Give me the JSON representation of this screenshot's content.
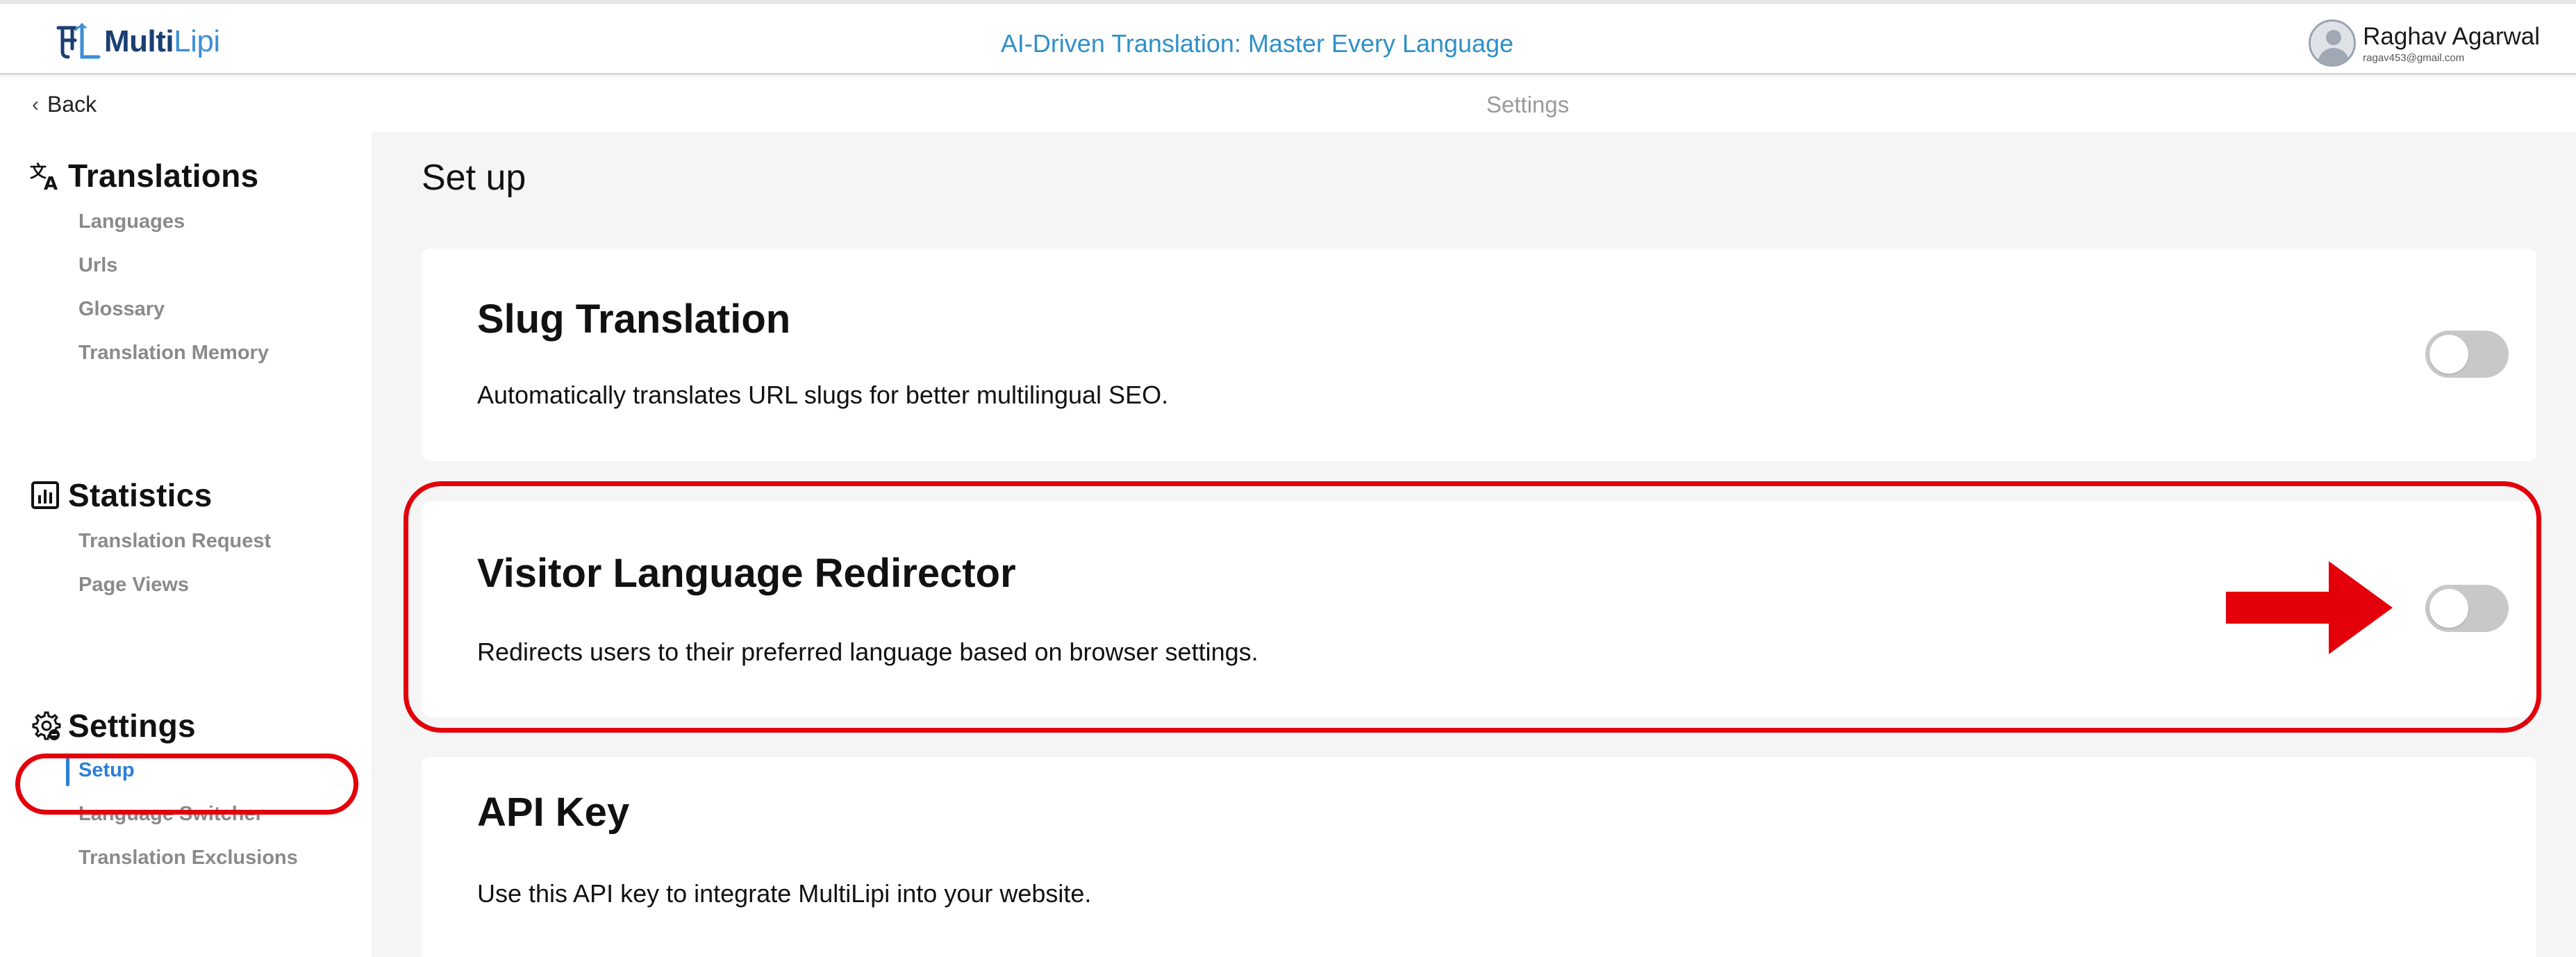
{
  "header": {
    "logo_primary": "Multi",
    "logo_secondary": "Lipi",
    "tagline": "AI-Driven Translation: Master Every Language",
    "user": {
      "name": "Raghav Agarwal",
      "email": "ragav453@gmail.com"
    }
  },
  "subbar": {
    "back_label": "Back",
    "breadcrumb": "Settings"
  },
  "sidebar": {
    "translations": {
      "title": "Translations",
      "items": [
        "Languages",
        "Urls",
        "Glossary",
        "Translation Memory"
      ]
    },
    "statistics": {
      "title": "Statistics",
      "items": [
        "Translation Request",
        "Page Views"
      ]
    },
    "settings": {
      "title": "Settings",
      "items": [
        "Setup",
        "Language Switcher",
        "Translation Exclusions"
      ],
      "active": "Setup"
    }
  },
  "main": {
    "title": "Set up",
    "cards": [
      {
        "title": "Slug Translation",
        "description": "Automatically translates URL slugs for better multilingual SEO.",
        "toggle_on": false
      },
      {
        "title": "Visitor Language Redirector",
        "description": "Redirects users to their preferred language based on browser settings.",
        "toggle_on": false
      },
      {
        "title": "API Key",
        "description": "Use this API key to integrate MultiLipi into your website."
      }
    ]
  },
  "colors": {
    "accent": "#2c7fd6",
    "annotation": "#e3000b",
    "tagline": "#2e90c9"
  }
}
